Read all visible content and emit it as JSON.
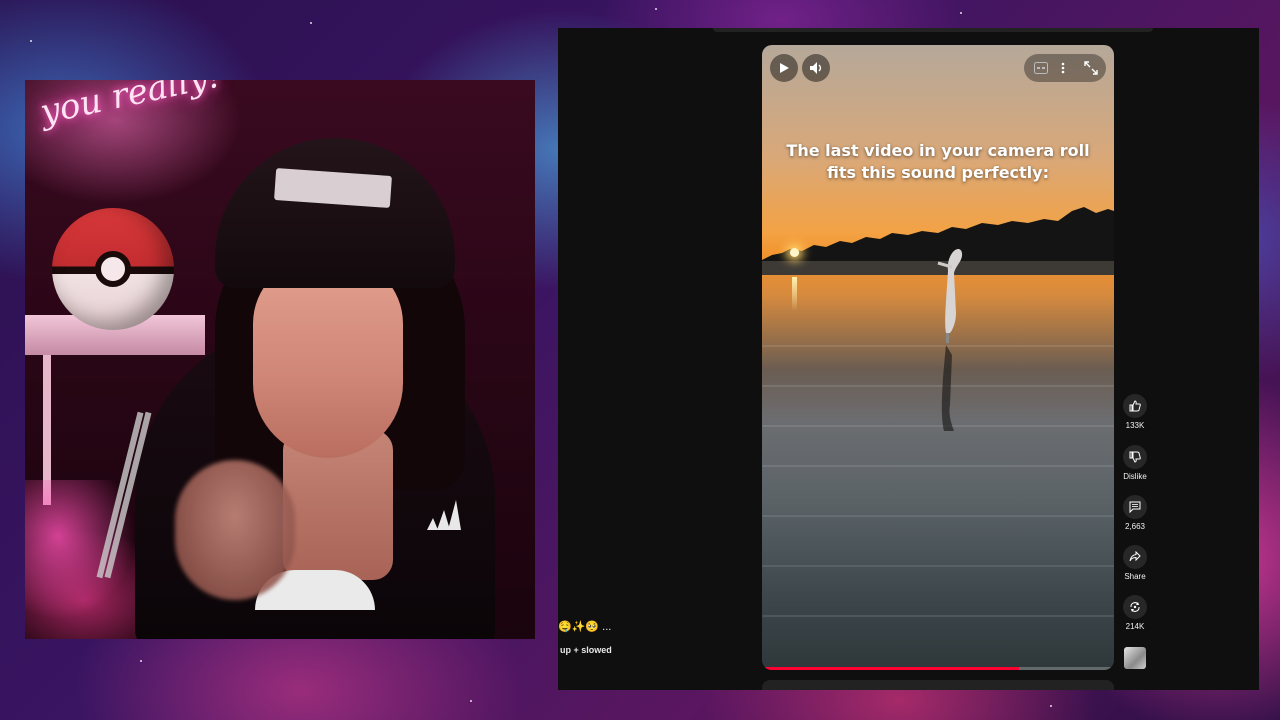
{
  "webcam": {
    "neon_sign": "you really!"
  },
  "player": {
    "caption_line1": "The last video in your camera roll",
    "caption_line2": "fits this sound perfectly:",
    "progress": 0.73,
    "play_icon": "play-icon",
    "volume_icon": "volume-icon",
    "captions_icon": "captions-icon",
    "more_icon": "more-vert-icon",
    "fullscreen_icon": "fullscreen-icon"
  },
  "actions": {
    "like": "133K",
    "dislike": "Dislike",
    "comments": "2,663",
    "share": "Share",
    "remix": "214K"
  },
  "sound": {
    "emojis": "🤤✨🥺 ...",
    "title": "up + slowed"
  },
  "colors": {
    "progress": "#ff0033",
    "panel_bg": "#0f0f0f",
    "button_bg": "#272727"
  }
}
